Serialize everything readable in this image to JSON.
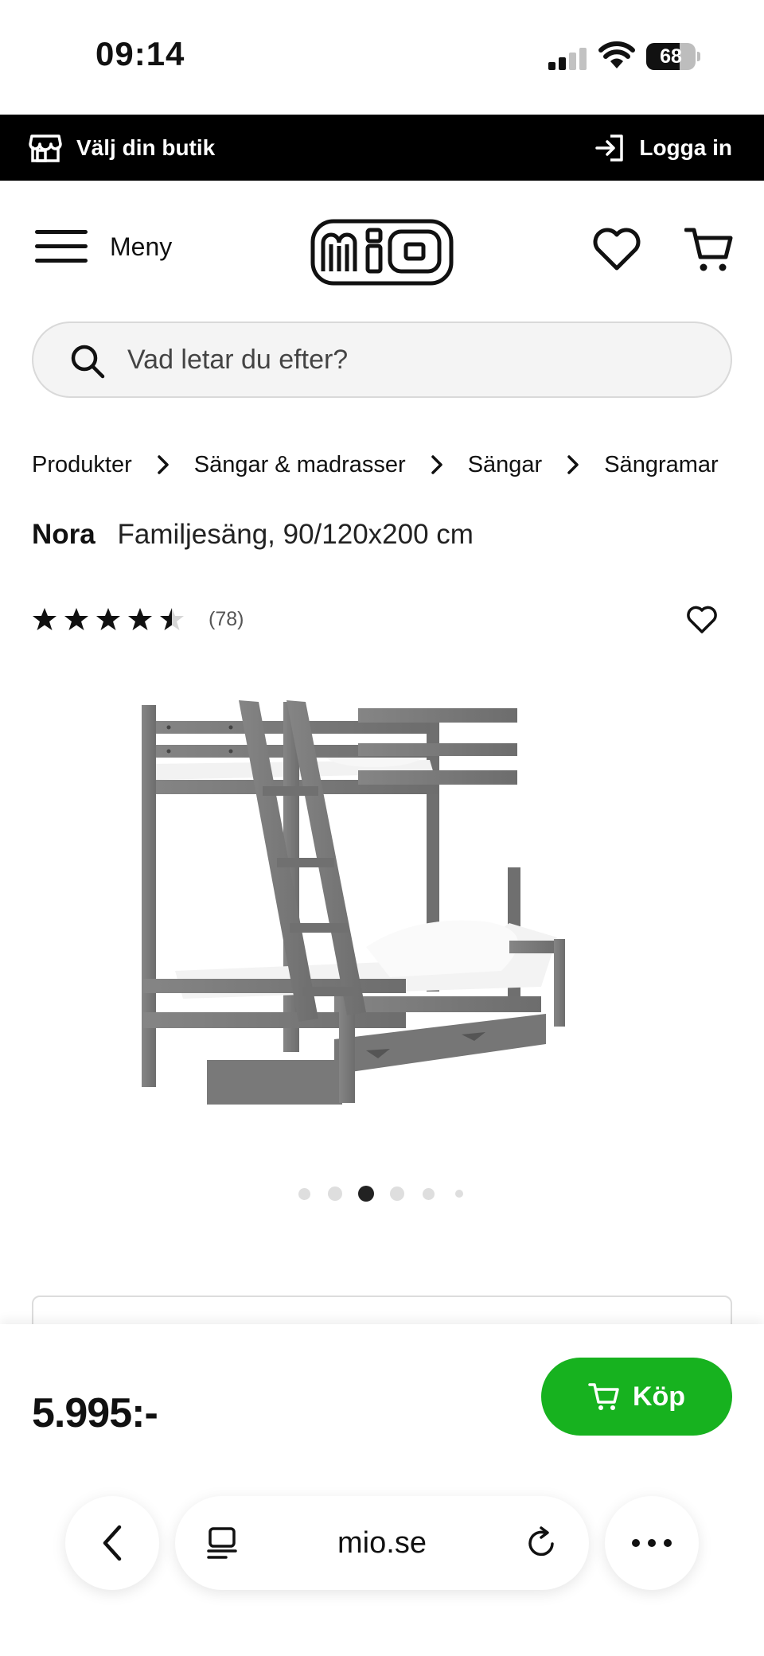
{
  "status_bar": {
    "time": "09:14",
    "battery_level": "68",
    "battery_fraction": 0.68
  },
  "store_bar": {
    "store_label": "Välj din butik",
    "login_label": "Logga in"
  },
  "header": {
    "menu_label": "Meny",
    "logo_text": "mio"
  },
  "search": {
    "placeholder": "Vad letar du efter?"
  },
  "breadcrumb": [
    "Produkter",
    "Sängar & madrasser",
    "Sängar",
    "Sängramar"
  ],
  "product": {
    "name": "Nora",
    "description": "Familjesäng, 90/120x200 cm",
    "rating": 4.5,
    "rating_max": 5,
    "review_count": "(78)",
    "price": "5.995:-",
    "buy_label": "Köp",
    "image_count": 6,
    "active_image_index": 2
  },
  "browser": {
    "url": "mio.se"
  },
  "colors": {
    "accent_green": "#17b21f",
    "top_bar": "#000000",
    "bed_frame": "#7a7a7a"
  }
}
